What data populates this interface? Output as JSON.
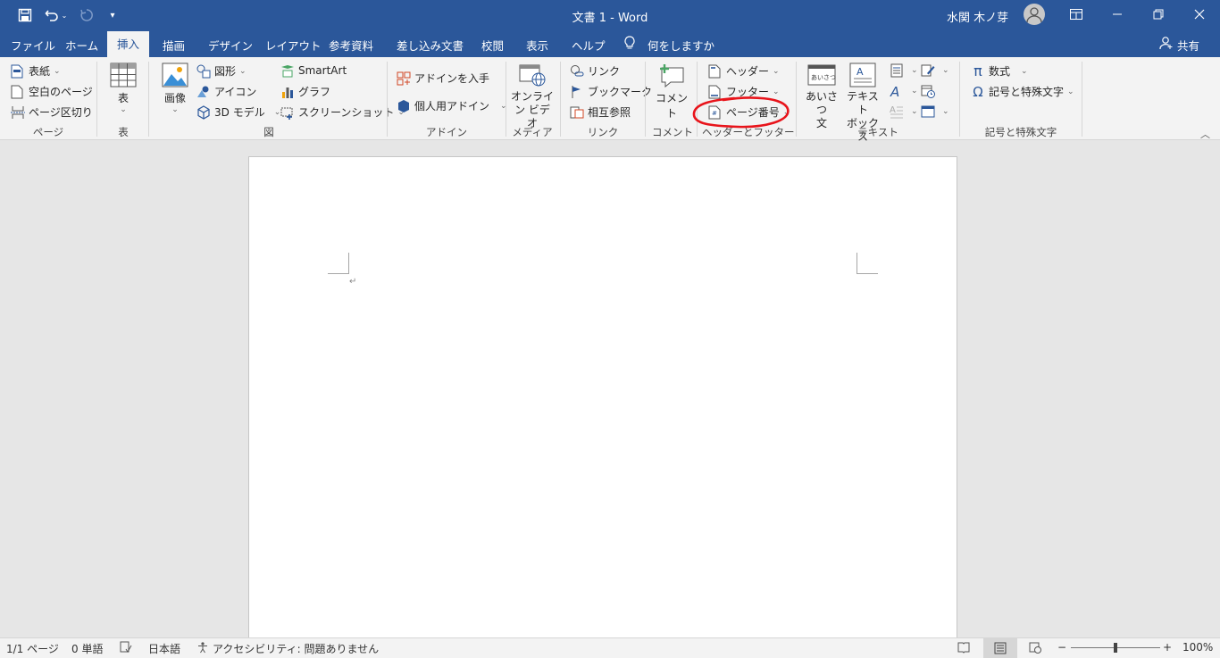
{
  "window": {
    "title": "文書 1 - Word",
    "user_name": "水関 木ノ芽",
    "qat": [
      "save-icon",
      "undo-icon",
      "redo-icon",
      "customize-icon"
    ]
  },
  "tabs": [
    {
      "label": "ファイル"
    },
    {
      "label": "ホーム"
    },
    {
      "label": "挿入",
      "active": true
    },
    {
      "label": "描画"
    },
    {
      "label": "デザイン"
    },
    {
      "label": "レイアウト"
    },
    {
      "label": "参考資料"
    },
    {
      "label": "差し込み文書"
    },
    {
      "label": "校閲"
    },
    {
      "label": "表示"
    },
    {
      "label": "ヘルプ"
    }
  ],
  "tell_me": "何をしますか",
  "share": "共有",
  "ribbon": {
    "pages": {
      "label": "ページ",
      "cover": "表紙",
      "blank": "空白のページ",
      "break": "ページ区切り"
    },
    "tables": {
      "label": "表",
      "table": "表"
    },
    "illustrations": {
      "label": "図",
      "pictures": "画像",
      "shapes": "図形",
      "icons": "アイコン",
      "model3d": "3D モデル",
      "smartart": "SmartArt",
      "chart": "グラフ",
      "screenshot": "スクリーンショット"
    },
    "addins": {
      "label": "アドイン",
      "get": "アドインを入手",
      "my": "個人用アドイン"
    },
    "media": {
      "label": "メディア",
      "online_video_1": "オンライ",
      "online_video_2": "ン ビデオ"
    },
    "links": {
      "label": "リンク",
      "link": "リンク",
      "bookmark": "ブックマーク",
      "crossref": "相互参照"
    },
    "comments": {
      "label": "コメント",
      "comment": "コメント"
    },
    "header_footer": {
      "label": "ヘッダーとフッター",
      "header": "ヘッダー",
      "footer": "フッター",
      "page_number": "ページ番号"
    },
    "text": {
      "label": "テキスト",
      "greeting_1": "あいさつ",
      "greeting_2": "文",
      "greeting_icon": "あいさつ",
      "textbox_1": "テキスト",
      "textbox_2": "ボックス"
    },
    "symbols": {
      "label": "記号と特殊文字",
      "equation": "数式",
      "symbol": "記号と特殊文字"
    }
  },
  "annotation": {
    "color": "#e8141b",
    "target": "ページ番号"
  },
  "statusbar": {
    "page": "1/1 ページ",
    "words": "0 単語",
    "language": "日本語",
    "accessibility": "アクセシビリティ: 問題ありません",
    "zoom": "100%",
    "zoom_minus": "−",
    "zoom_plus": "+",
    "zoom_level_percent": 100
  },
  "colors": {
    "accent": "#2b579a",
    "ribbon_bg": "#f3f3f3",
    "canvas_bg": "#e6e6e6"
  }
}
